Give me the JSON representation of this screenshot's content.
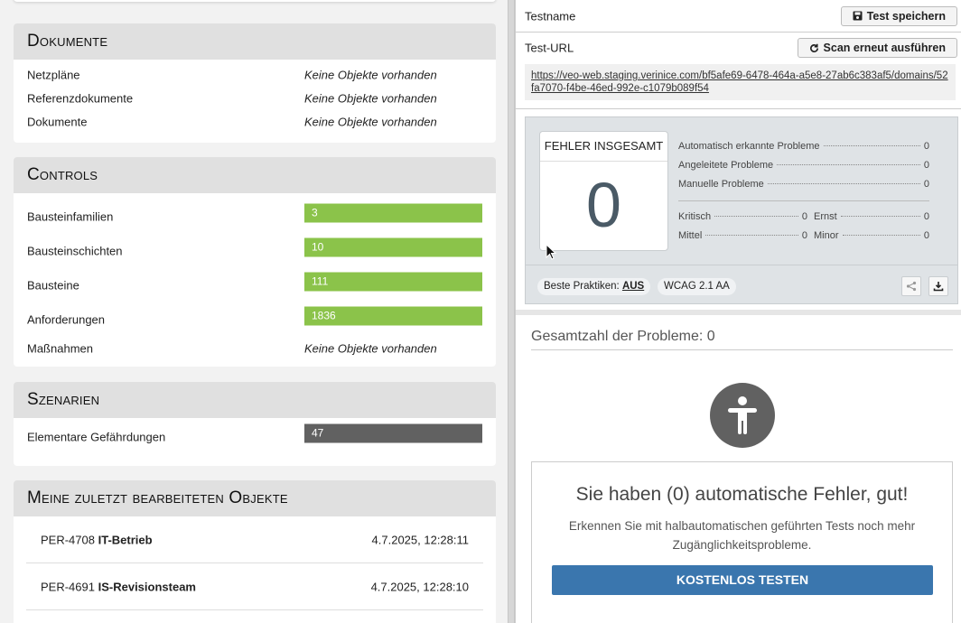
{
  "left": {
    "dokumente": {
      "title": "Dokumente",
      "rows": [
        {
          "label": "Netzpläne",
          "value": "Keine Objekte vorhanden"
        },
        {
          "label": "Referenzdokumente",
          "value": "Keine Objekte vorhanden"
        },
        {
          "label": "Dokumente",
          "value": "Keine Objekte vorhanden"
        }
      ]
    },
    "controls": {
      "title": "Controls",
      "rows": [
        {
          "label": "Bausteinfamilien",
          "value": "3"
        },
        {
          "label": "Bausteinschichten",
          "value": "10"
        },
        {
          "label": "Bausteine",
          "value": "111"
        },
        {
          "label": "Anforderungen",
          "value": "1836"
        },
        {
          "label": "Maßnahmen",
          "value": "Keine Objekte vorhanden"
        }
      ]
    },
    "szenarien": {
      "title": "Szenarien",
      "rows": [
        {
          "label": "Elementare Gefährdungen",
          "value": "47"
        }
      ]
    },
    "recent": {
      "title": "Meine zuletzt bearbeiteten Objekte",
      "rows": [
        {
          "id": "PER-4708",
          "name": "IT-Betrieb",
          "date": "4.7.2025, 12:28:11"
        },
        {
          "id": "PER-4691",
          "name": "IS-Revisionsteam",
          "date": "4.7.2025, 12:28:10"
        }
      ]
    }
  },
  "right": {
    "testname_label": "Testname",
    "save_button": "Test speichern",
    "testurl_label": "Test-URL",
    "rescan_button": "Scan erneut ausführen",
    "url": "https://veo-web.staging.verinice.com/bf5afe69-6478-464a-a5e8-27ab6c383af5/domains/52fa7070-f4be-46ed-992e-c1079b089f54",
    "summary": {
      "total_title": "FEHLER INSGESAMT",
      "total_value": "0",
      "auto_label": "Automatisch erkannte Probleme",
      "auto_value": "0",
      "guided_label": "Angeleitete Probleme",
      "guided_value": "0",
      "manual_label": "Manuelle Probleme",
      "manual_value": "0",
      "critical_label": "Kritisch",
      "critical_value": "0",
      "serious_label": "Ernst",
      "serious_value": "0",
      "moderate_label": "Mittel",
      "moderate_value": "0",
      "minor_label": "Minor",
      "minor_value": "0",
      "best_practices_label": "Beste Praktiken:",
      "best_practices_value": "AUS",
      "standard": "WCAG 2.1 AA"
    },
    "total_issues": "Gesamtzahl der Probleme: 0",
    "result_title": "Sie haben (0) automatische Fehler, gut!",
    "result_text": "Erkennen Sie mit halbautomatischen geführten Tests noch mehr Zugänglichkeitsprobleme.",
    "cta": "KOSTENLOS TESTEN"
  }
}
